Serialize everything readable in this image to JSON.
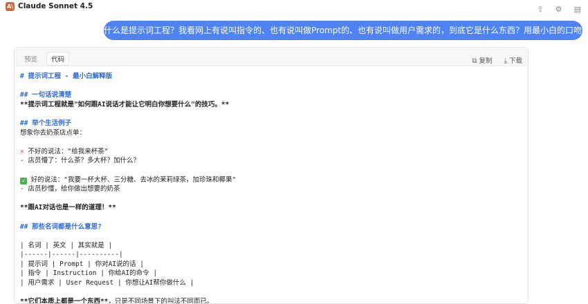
{
  "app": {
    "logo_text": "A\\",
    "model_name": "Claude Sonnet 4.5",
    "dropdown_caret": "⌄"
  },
  "user_message": "什么是提示词工程？我看网上有说叫指令的、也有说叫做Prompt的、也有说叫做用户需求的，到底它是什么东西？用最小白的口吻给我解释清楚。",
  "artifact": {
    "tabs": [
      "预览",
      "代码"
    ],
    "active_tab": "代码",
    "copy_label": "复制",
    "download_label": "下载"
  },
  "code": {
    "l01": "# 提示词工程 - 最小白解释版",
    "l03": "## 一句话说清楚",
    "l04": "**提示词工程就是\"如何跟AI说话才能让它明白你想要什么\"的技巧。**",
    "l06": "## 举个生活例子",
    "l07": "想象你去奶茶店点单：",
    "l09_mark": "✕",
    "l09": "不好的说法：\"给我来杯茶\"",
    "l10": "- 店员懵了：什么茶？多大杯？加什么？",
    "l12_mark": "✓",
    "l12": "好的说法：\"我要一杯大杯、三分糖、去冰的茉莉绿茶，加珍珠和椰果\"",
    "l13": "- 店员秒懂，给你做出想要的奶茶",
    "l15": "**跟AI对话也是一样的道理！**",
    "l17": "## 那些名词都是什么意思?",
    "l19": "| 名词 | 英文 | 其实就是 |",
    "l20": "|------|------|----------|",
    "l21": "| 提示词 | Prompt | 你对AI说的话 |",
    "l22": "| 指令 | Instruction | 你给AI的命令 |",
    "l23": "| 用户需求 | User Request | 你想让AI帮你做什么 |",
    "l25a": "**它们本质上都是一个东西**",
    "l25b": "，只是不同场景下的叫法不同而已。"
  }
}
